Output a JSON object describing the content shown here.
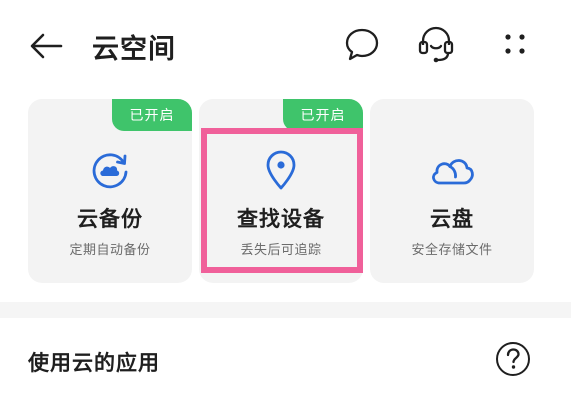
{
  "header": {
    "title": "云空间",
    "back_icon": "arrow-left-icon",
    "message_icon": "chat-bubble-icon",
    "support_icon": "headset-icon",
    "more_icon": "four-dots-menu-icon"
  },
  "cards": [
    {
      "title": "云备份",
      "subtitle": "定期自动备份",
      "badge": "已开启",
      "icon": "cloud-sync-icon"
    },
    {
      "title": "查找设备",
      "subtitle": "丢失后可追踪",
      "badge": "已开启",
      "icon": "location-pin-icon"
    },
    {
      "title": "云盘",
      "subtitle": "安全存储文件",
      "icon": "cloud-icon"
    }
  ],
  "section": {
    "title": "使用云的应用",
    "help_icon": "question-mark-circle-icon"
  },
  "colors": {
    "accent_blue": "#2a6bd8",
    "badge_green": "#3fc46b",
    "highlight_pink": "#f0609a",
    "card_bg": "#f3f3f3"
  }
}
